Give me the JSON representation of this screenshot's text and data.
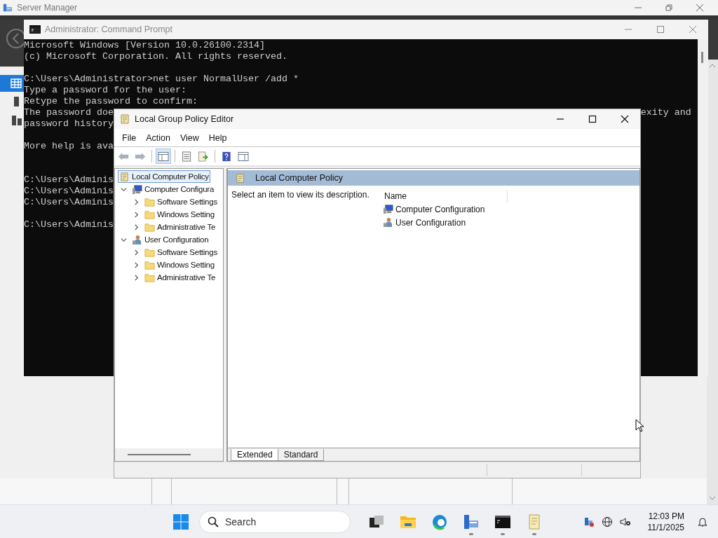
{
  "server_manager": {
    "title": "Server Manager"
  },
  "command_prompt": {
    "title": "Administrator: Command Prompt",
    "lines": [
      {
        "kind": "text",
        "text": "Microsoft Windows [Version 10.0.26100.2314]"
      },
      {
        "kind": "text",
        "text": "(c) Microsoft Corporation. All rights reserved."
      },
      {
        "kind": "blank"
      },
      {
        "kind": "text",
        "text": "C:\\Users\\Administrator>net user NormalUser /add *"
      },
      {
        "kind": "text",
        "text": "Type a password for the user:"
      },
      {
        "kind": "text",
        "text": "Retype the password to confirm:"
      },
      {
        "kind": "text",
        "text": "The password doe",
        "tail": "exity and"
      },
      {
        "kind": "text",
        "text": "password history"
      },
      {
        "kind": "blank"
      },
      {
        "kind": "text",
        "text": "More help is ava"
      },
      {
        "kind": "blank"
      },
      {
        "kind": "blank"
      },
      {
        "kind": "text",
        "text": "C:\\Users\\Adminis"
      },
      {
        "kind": "text",
        "text": "C:\\Users\\Adminis"
      },
      {
        "kind": "text",
        "text": "C:\\Users\\Adminis"
      },
      {
        "kind": "blank"
      },
      {
        "kind": "text",
        "text": "C:\\Users\\Adminis"
      }
    ]
  },
  "group_policy_editor": {
    "title": "Local Group Policy Editor",
    "menu": [
      "File",
      "Action",
      "View",
      "Help"
    ],
    "toolbar": [
      {
        "kind": "back",
        "disabled": true
      },
      {
        "kind": "forward",
        "disabled": true
      },
      {
        "kind": "separator"
      },
      {
        "kind": "tree",
        "pressed": true
      },
      {
        "kind": "separator"
      },
      {
        "kind": "properties",
        "pressed": false
      },
      {
        "kind": "export",
        "pressed": false
      },
      {
        "kind": "separator"
      },
      {
        "kind": "help",
        "pressed": false
      },
      {
        "kind": "pane",
        "pressed": false
      }
    ],
    "tree": [
      {
        "kind": "policy",
        "label": "Local Computer Policy",
        "selected": true,
        "children": [
          {
            "kind": "computer",
            "label": "Computer Configura",
            "selected": false,
            "expanded": true,
            "children": [
              {
                "kind": "folder",
                "label": "Software Settings",
                "selected": false,
                "expanded": false
              },
              {
                "kind": "folder",
                "label": "Windows Setting",
                "selected": false,
                "expanded": false
              },
              {
                "kind": "folder",
                "label": "Administrative Te",
                "selected": false,
                "expanded": false
              }
            ]
          },
          {
            "kind": "user",
            "label": "User Configuration",
            "selected": false,
            "expanded": true,
            "children": [
              {
                "kind": "folder",
                "label": "Software Settings",
                "selected": false,
                "expanded": false
              },
              {
                "kind": "folder",
                "label": "Windows Setting",
                "selected": false,
                "expanded": false
              },
              {
                "kind": "folder",
                "label": "Administrative Te",
                "selected": false,
                "expanded": false
              }
            ]
          }
        ]
      }
    ],
    "details": {
      "header": "Local Computer Policy",
      "description": "Select an item to view its description.",
      "column": "Name",
      "items": [
        {
          "kind": "computer",
          "label": "Computer Configuration"
        },
        {
          "kind": "user",
          "label": "User Configuration"
        }
      ]
    },
    "tabs": [
      {
        "label": "Extended",
        "selected": true
      },
      {
        "label": "Standard",
        "selected": false
      }
    ]
  },
  "taskbar": {
    "search": {
      "placeholder": "Search"
    },
    "apps": [
      {
        "kind": "task-view",
        "running": false
      },
      {
        "kind": "explorer",
        "running": false
      },
      {
        "kind": "edge",
        "running": false
      },
      {
        "kind": "server-manager",
        "running": true
      },
      {
        "kind": "terminal",
        "running": true
      },
      {
        "kind": "notepad",
        "running": true
      }
    ],
    "time": "12:03 PM",
    "date": "11/1/2025"
  }
}
